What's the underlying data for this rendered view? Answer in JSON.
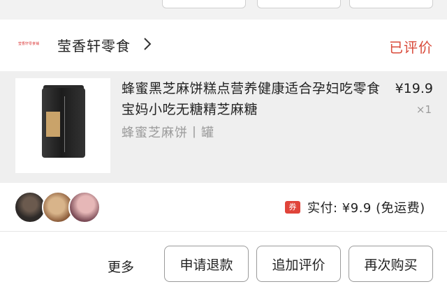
{
  "shop": {
    "logo_text": "莹香轩零食铺",
    "name": "莹香轩零食",
    "status": "已评价"
  },
  "item": {
    "title": "蜂蜜黑芝麻饼糕点营养健康适合孕妇吃零食宝妈小吃无糖精芝麻糖",
    "spec": "蜂蜜芝麻饼丨罐",
    "price": "¥19.9",
    "quantity": "×1"
  },
  "summary": {
    "coupon_label": "券",
    "paid_text": "实付: ¥9.9 (免运费)"
  },
  "actions": {
    "more": "更多",
    "refund": "申请退款",
    "add_review": "追加评价",
    "rebuy": "再次购买"
  },
  "colors": {
    "accent": "#d94a3a",
    "coupon": "#e0443a"
  }
}
